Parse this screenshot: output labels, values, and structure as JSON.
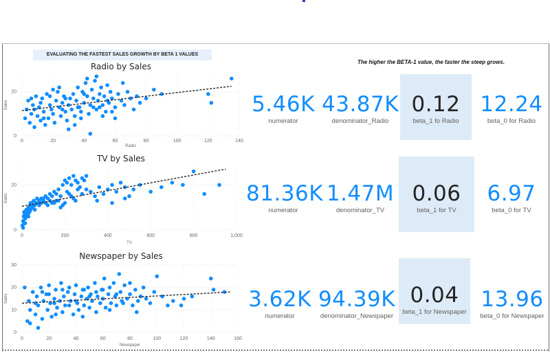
{
  "banner": "EVALUATING THE FASTEST SALES GROWTH BY BETA 1 VALUES",
  "note": "The higher the BETA-1 value, the faster the steep grows.",
  "colors": {
    "accent": "#118dff",
    "highlight_bg": "#ddebf8",
    "point": "#118dff",
    "trend": "#252423"
  },
  "rows": [
    {
      "kpis": [
        {
          "value": "5.46K",
          "label": "numerator"
        },
        {
          "value": "43.87K",
          "label": "denominator_Radio"
        },
        {
          "value": "0.12",
          "label": "beta_1 fo Radio"
        },
        {
          "value": "12.24",
          "label": "beta_0 for Radio"
        }
      ]
    },
    {
      "kpis": [
        {
          "value": "81.36K",
          "label": "numerator"
        },
        {
          "value": "1.47M",
          "label": "denominator_TV"
        },
        {
          "value": "0.06",
          "label": "beta_1 for TV"
        },
        {
          "value": "6.97",
          "label": "beta_0 for TV"
        }
      ]
    },
    {
      "kpis": [
        {
          "value": "3.62K",
          "label": "numerator"
        },
        {
          "value": "94.39K",
          "label": "denominator_Newspaper"
        },
        {
          "value": "0.04",
          "label": "beta_1 for Newspaper"
        },
        {
          "value": "13.96",
          "label": "beta_0 for Newspaper"
        }
      ]
    }
  ],
  "chart_data": [
    {
      "type": "scatter",
      "title": "Radio by Sales",
      "xlabel": "Radio",
      "ylabel": "Sales",
      "xlim": [
        0,
        140
      ],
      "ylim": [
        0,
        28
      ],
      "xticks": [
        "0",
        "20",
        "40",
        "60",
        "80",
        "100",
        "120",
        "140"
      ],
      "yticks": [
        "0",
        "20"
      ],
      "trend": {
        "x": [
          0,
          135
        ],
        "y": [
          11.5,
          22.5
        ]
      },
      "points": [
        [
          2,
          8
        ],
        [
          3,
          12
        ],
        [
          4,
          16
        ],
        [
          5,
          6
        ],
        [
          6,
          10
        ],
        [
          7,
          14
        ],
        [
          8,
          4
        ],
        [
          9,
          18
        ],
        [
          10,
          9
        ],
        [
          11,
          13
        ],
        [
          12,
          7
        ],
        [
          13,
          17
        ],
        [
          14,
          11
        ],
        [
          15,
          5
        ],
        [
          16,
          19
        ],
        [
          17,
          8
        ],
        [
          18,
          14
        ],
        [
          19,
          12
        ],
        [
          20,
          10
        ],
        [
          21,
          6
        ],
        [
          22,
          16
        ],
        [
          23,
          20
        ],
        [
          24,
          13
        ],
        [
          25,
          9
        ],
        [
          26,
          15
        ],
        [
          27,
          18
        ],
        [
          28,
          11
        ],
        [
          29,
          7
        ],
        [
          30,
          14
        ],
        [
          31,
          17
        ],
        [
          32,
          12
        ],
        [
          33,
          19
        ],
        [
          34,
          9
        ],
        [
          35,
          16
        ],
        [
          36,
          22
        ],
        [
          37,
          13
        ],
        [
          38,
          11
        ],
        [
          39,
          20
        ],
        [
          40,
          15
        ],
        [
          41,
          24
        ],
        [
          42,
          18
        ],
        [
          43,
          10
        ],
        [
          44,
          14
        ],
        [
          45,
          21
        ],
        [
          46,
          17
        ],
        [
          47,
          25
        ],
        [
          48,
          12
        ],
        [
          49,
          16
        ],
        [
          50,
          19
        ],
        [
          51,
          22
        ],
        [
          52,
          14
        ],
        [
          53,
          18
        ],
        [
          54,
          11
        ],
        [
          55,
          23
        ],
        [
          56,
          15
        ],
        [
          57,
          20
        ],
        [
          58,
          17
        ],
        [
          60,
          13
        ],
        [
          62,
          19
        ],
        [
          64,
          16
        ],
        [
          66,
          14
        ],
        [
          68,
          20
        ],
        [
          70,
          17
        ],
        [
          72,
          12
        ],
        [
          74,
          18
        ],
        [
          76,
          15
        ],
        [
          80,
          17
        ],
        [
          85,
          21
        ],
        [
          90,
          19
        ],
        [
          42,
          26
        ],
        [
          38,
          8
        ],
        [
          30,
          3
        ],
        [
          44,
          1
        ],
        [
          48,
          27
        ],
        [
          52,
          9
        ],
        [
          60,
          8
        ],
        [
          65,
          24
        ],
        [
          24,
          22
        ],
        [
          18,
          18
        ],
        [
          12,
          15
        ],
        [
          8,
          12
        ],
        [
          6,
          17
        ],
        [
          34,
          5
        ],
        [
          58,
          11
        ],
        [
          46,
          13
        ],
        [
          120,
          19
        ],
        [
          122,
          15
        ],
        [
          135,
          26
        ],
        [
          28,
          17
        ],
        [
          36,
          13
        ],
        [
          40,
          19
        ],
        [
          50,
          13
        ],
        [
          55,
          16
        ],
        [
          14,
          8
        ],
        [
          20,
          21
        ],
        [
          26,
          12
        ]
      ]
    },
    {
      "type": "scatter",
      "title": "TV by Sales",
      "xlabel": "TV",
      "ylabel": "Sales",
      "xlim": [
        0,
        1000
      ],
      "ylim": [
        0,
        28
      ],
      "xticks": [
        "0",
        "200",
        "400",
        "600",
        "800",
        "1,000"
      ],
      "yticks": [
        "0",
        "20"
      ],
      "trend": {
        "x": [
          0,
          950
        ],
        "y": [
          10.5,
          27
        ]
      },
      "points": [
        [
          2,
          2
        ],
        [
          5,
          4
        ],
        [
          8,
          6
        ],
        [
          10,
          3
        ],
        [
          12,
          7
        ],
        [
          15,
          5
        ],
        [
          18,
          8
        ],
        [
          20,
          6
        ],
        [
          25,
          9
        ],
        [
          28,
          7
        ],
        [
          30,
          10
        ],
        [
          35,
          8
        ],
        [
          38,
          11
        ],
        [
          40,
          9
        ],
        [
          45,
          12
        ],
        [
          50,
          10
        ],
        [
          55,
          13
        ],
        [
          60,
          11
        ],
        [
          65,
          12
        ],
        [
          70,
          14
        ],
        [
          75,
          12
        ],
        [
          80,
          13
        ],
        [
          90,
          14
        ],
        [
          100,
          13
        ],
        [
          110,
          15
        ],
        [
          120,
          14
        ],
        [
          130,
          16
        ],
        [
          140,
          15
        ],
        [
          150,
          17
        ],
        [
          160,
          16
        ],
        [
          170,
          18
        ],
        [
          180,
          15
        ],
        [
          190,
          20
        ],
        [
          200,
          22
        ],
        [
          210,
          21
        ],
        [
          220,
          23
        ],
        [
          230,
          20
        ],
        [
          240,
          24
        ],
        [
          250,
          22
        ],
        [
          260,
          21
        ],
        [
          270,
          19
        ],
        [
          280,
          23
        ],
        [
          290,
          22
        ],
        [
          300,
          24
        ],
        [
          180,
          10
        ],
        [
          200,
          12
        ],
        [
          220,
          16
        ],
        [
          240,
          14
        ],
        [
          260,
          18
        ],
        [
          150,
          12
        ],
        [
          170,
          13
        ],
        [
          190,
          11
        ],
        [
          210,
          17
        ],
        [
          230,
          15
        ],
        [
          250,
          13
        ],
        [
          280,
          16
        ],
        [
          300,
          18
        ],
        [
          320,
          17
        ],
        [
          340,
          15
        ],
        [
          360,
          19
        ],
        [
          380,
          16
        ],
        [
          400,
          18
        ],
        [
          420,
          20
        ],
        [
          440,
          17
        ],
        [
          460,
          21
        ],
        [
          480,
          19
        ],
        [
          500,
          15
        ],
        [
          520,
          18
        ],
        [
          550,
          20
        ],
        [
          600,
          17
        ],
        [
          650,
          19
        ],
        [
          700,
          21
        ],
        [
          750,
          20
        ],
        [
          800,
          26
        ],
        [
          850,
          16
        ],
        [
          920,
          20
        ],
        [
          120,
          11
        ],
        [
          140,
          12
        ],
        [
          160,
          13
        ],
        [
          130,
          13
        ],
        [
          110,
          12
        ],
        [
          100,
          14
        ],
        [
          90,
          12
        ],
        [
          80,
          11
        ],
        [
          60,
          9
        ],
        [
          50,
          11
        ],
        [
          40,
          12
        ],
        [
          30,
          6
        ],
        [
          20,
          9
        ],
        [
          15,
          3
        ],
        [
          10,
          8
        ],
        [
          5,
          1
        ],
        [
          350,
          13
        ],
        [
          420,
          12
        ],
        [
          480,
          14
        ]
      ]
    },
    {
      "type": "scatter",
      "title": "Newspaper by Sales",
      "xlabel": "Newspaper",
      "ylabel": "Sales",
      "xlim": [
        0,
        160
      ],
      "ylim": [
        0,
        30
      ],
      "xticks": [
        "0",
        "20",
        "40",
        "60",
        "80",
        "100",
        "120",
        "140",
        "160"
      ],
      "yticks": [
        "0",
        "10",
        "20",
        "30"
      ],
      "trend": {
        "x": [
          0,
          155
        ],
        "y": [
          13,
          18
        ]
      },
      "points": [
        [
          2,
          20
        ],
        [
          4,
          5
        ],
        [
          5,
          14
        ],
        [
          6,
          10
        ],
        [
          8,
          18
        ],
        [
          10,
          8
        ],
        [
          11,
          16
        ],
        [
          12,
          12
        ],
        [
          14,
          20
        ],
        [
          15,
          6
        ],
        [
          16,
          14
        ],
        [
          18,
          17
        ],
        [
          19,
          10
        ],
        [
          20,
          21
        ],
        [
          21,
          13
        ],
        [
          22,
          7
        ],
        [
          24,
          15
        ],
        [
          25,
          19
        ],
        [
          26,
          11
        ],
        [
          28,
          14
        ],
        [
          29,
          22
        ],
        [
          30,
          9
        ],
        [
          31,
          16
        ],
        [
          32,
          12
        ],
        [
          34,
          18
        ],
        [
          35,
          20
        ],
        [
          36,
          14
        ],
        [
          38,
          8
        ],
        [
          39,
          17
        ],
        [
          40,
          21
        ],
        [
          41,
          13
        ],
        [
          42,
          10
        ],
        [
          44,
          16
        ],
        [
          45,
          19
        ],
        [
          46,
          12
        ],
        [
          48,
          15
        ],
        [
          49,
          20
        ],
        [
          50,
          11
        ],
        [
          51,
          17
        ],
        [
          52,
          14
        ],
        [
          54,
          22
        ],
        [
          55,
          9
        ],
        [
          56,
          16
        ],
        [
          58,
          13
        ],
        [
          59,
          19
        ],
        [
          60,
          15
        ],
        [
          61,
          24
        ],
        [
          62,
          11
        ],
        [
          64,
          17
        ],
        [
          65,
          20
        ],
        [
          66,
          13
        ],
        [
          68,
          22
        ],
        [
          69,
          16
        ],
        [
          70,
          12
        ],
        [
          72,
          26
        ],
        [
          73,
          18
        ],
        [
          74,
          14
        ],
        [
          76,
          21
        ],
        [
          78,
          15
        ],
        [
          80,
          17
        ],
        [
          82,
          12
        ],
        [
          84,
          19
        ],
        [
          86,
          14
        ],
        [
          88,
          16
        ],
        [
          90,
          20
        ],
        [
          92,
          15
        ],
        [
          95,
          13
        ],
        [
          98,
          18
        ],
        [
          100,
          25
        ],
        [
          104,
          16
        ],
        [
          108,
          12
        ],
        [
          112,
          14
        ],
        [
          118,
          12
        ],
        [
          120,
          15
        ],
        [
          126,
          16
        ],
        [
          140,
          24
        ],
        [
          142,
          19
        ],
        [
          150,
          18
        ],
        [
          15,
          18
        ],
        [
          25,
          8
        ],
        [
          35,
          12
        ],
        [
          45,
          7
        ],
        [
          55,
          18
        ],
        [
          65,
          10
        ],
        [
          75,
          13
        ],
        [
          85,
          9
        ],
        [
          30,
          19
        ],
        [
          40,
          14
        ],
        [
          50,
          16
        ],
        [
          60,
          19
        ],
        [
          20,
          17
        ],
        [
          10,
          13
        ],
        [
          70,
          17
        ],
        [
          80,
          22
        ],
        [
          6,
          4
        ],
        [
          12,
          2
        ],
        [
          24,
          13
        ],
        [
          46,
          19
        ]
      ]
    }
  ]
}
